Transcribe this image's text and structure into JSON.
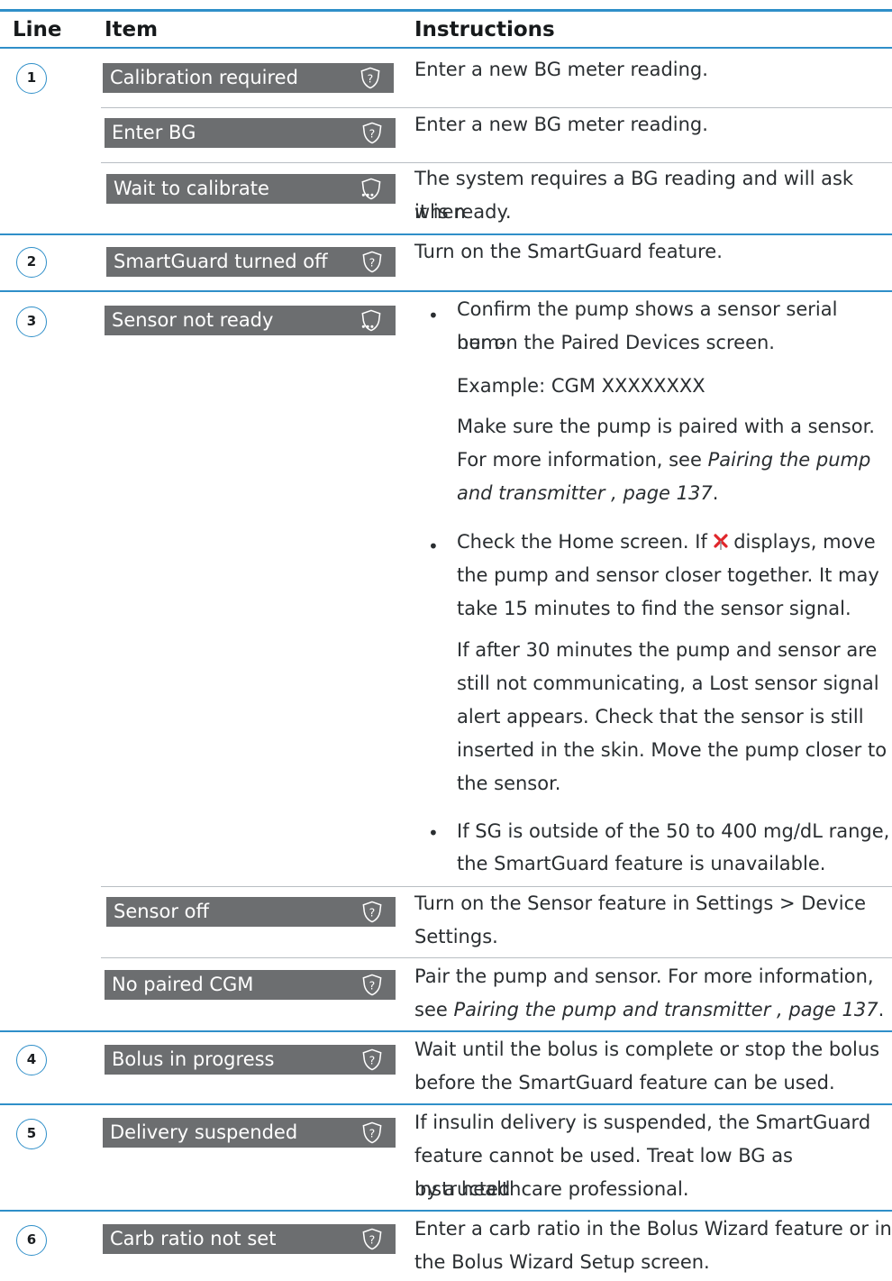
{
  "header": {
    "col_line": "Line",
    "col_item": "Item",
    "col_instructions": "Instructions"
  },
  "rows": {
    "r1": {
      "num": "1",
      "item": "Calibration required",
      "icon": "help-shield-icon",
      "text": "Enter a new BG meter reading."
    },
    "r1b": {
      "item": "Enter BG",
      "icon": "help-shield-icon",
      "text": "Enter a new BG meter reading."
    },
    "r1c": {
      "item": "Wait to calibrate",
      "icon": "waiting-shield-icon",
      "text_a": "The system requires a BG reading and will ask when",
      "text_b": "it is ready."
    },
    "r2": {
      "num": "2",
      "item": "SmartGuard turned off",
      "icon": "help-shield-icon",
      "text": "Turn on the SmartGuard feature."
    },
    "r3": {
      "num": "3",
      "item": "Sensor not ready",
      "icon": "waiting-shield-icon",
      "b1_l1": "Confirm the pump shows a sensor serial num-",
      "b1_l2": "ber on the Paired Devices screen.",
      "b1_ex": "Example: CGM XXXXXXXX",
      "b1_p1": "Make sure the pump is paired with a sensor.",
      "b1_p2a": "For more information, see ",
      "b1_p2b": "Pairing the pump",
      "b1_p3a": "and transmitter , page 137",
      "b1_p3b": ".",
      "b2_l1a": "Check the Home screen. If ",
      "b2_l1b": " displays, move",
      "b2_l2": "the pump and sensor closer together. It may",
      "b2_l3": "take 15 minutes to find the sensor signal.",
      "b2_p1": "If after 30 minutes the pump and sensor are",
      "b2_p2": "still not communicating, a Lost sensor signal",
      "b2_p3": "alert appears. Check that the sensor is still",
      "b2_p4": "inserted in the skin. Move the pump closer to",
      "b2_p5": "the sensor.",
      "b3_l1": "If SG is outside of the 50 to 400 mg/dL range,",
      "b3_l2": "the SmartGuard feature is unavailable."
    },
    "r3b": {
      "item": "Sensor off",
      "icon": "help-shield-icon",
      "text_a": "Turn on the Sensor feature in Settings > Device",
      "text_b": "Settings."
    },
    "r3c": {
      "item": "No paired CGM",
      "icon": "help-shield-icon",
      "text_a": "Pair the pump and sensor. For more information,",
      "text_b1": "see ",
      "text_b2": "Pairing the pump and transmitter , page 137",
      "text_b3": "."
    },
    "r4": {
      "num": "4",
      "item": "Bolus in progress",
      "icon": "help-shield-icon",
      "text_a": "Wait until the bolus is complete or stop the bolus",
      "text_b": "before the SmartGuard feature can be used."
    },
    "r5": {
      "num": "5",
      "item": "Delivery suspended",
      "icon": "help-shield-icon",
      "text_a": "If insulin delivery is suspended, the SmartGuard",
      "text_b": "feature cannot be used. Treat low BG as instructed",
      "text_c": "by a healthcare professional."
    },
    "r6": {
      "num": "6",
      "item": "Carb ratio not set",
      "icon": "help-shield-icon",
      "text_a": "Enter a carb ratio in the Bolus Wizard feature or in",
      "text_b": "the Bolus Wizard Setup screen."
    }
  },
  "bullet_char": "•",
  "colors": {
    "rule_blue": "#2f8fc9",
    "button_grey": "#6c6e70",
    "lost_signal_red": "#e0262b"
  }
}
